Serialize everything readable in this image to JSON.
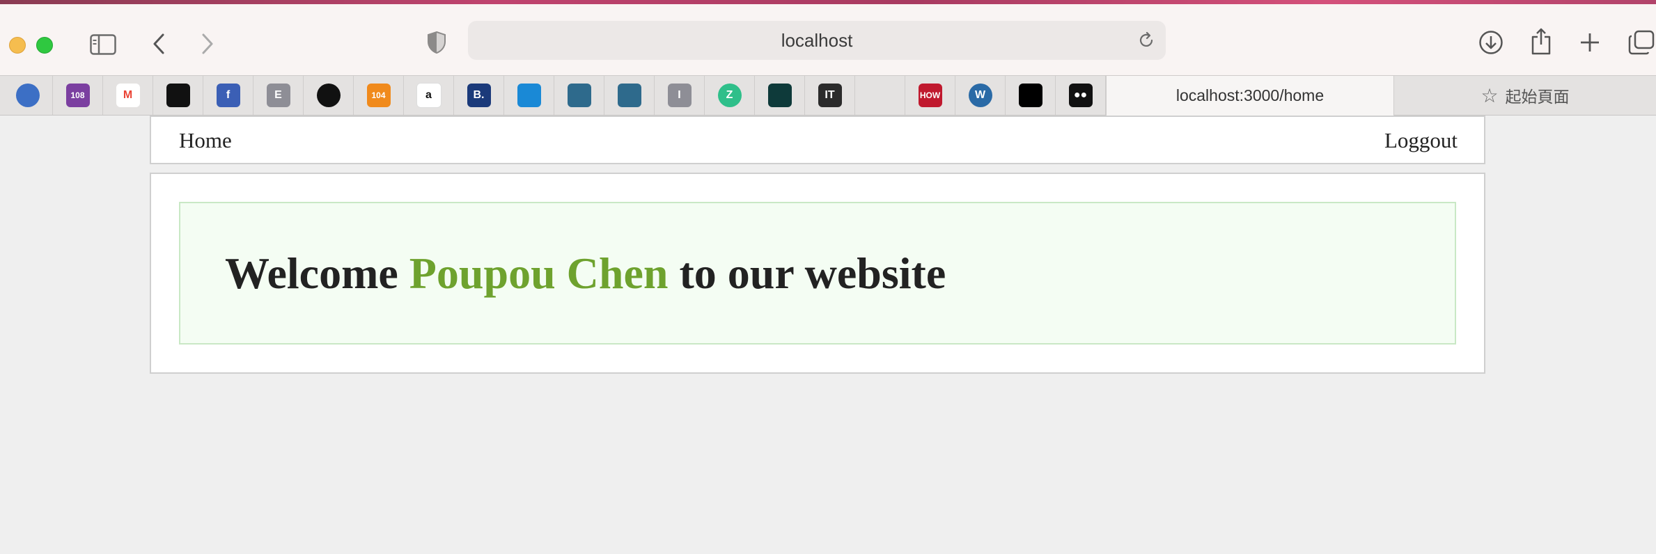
{
  "browser": {
    "address": "localhost",
    "active_tab": "localhost:3000/home",
    "other_tab": "起始頁面"
  },
  "favorites": [
    {
      "icon": "heartbeat-icon",
      "text": "",
      "color": "#3c6fc5"
    },
    {
      "icon": "108-icon",
      "text": "108",
      "color": "#7b3fa0"
    },
    {
      "icon": "gmail-icon",
      "text": "M",
      "color": "#ea4335"
    },
    {
      "icon": "github-icon",
      "text": "",
      "color": "#111111"
    },
    {
      "icon": "facebook-icon",
      "text": "f",
      "color": "#3b5fb5"
    },
    {
      "icon": "e-icon",
      "text": "E",
      "color": "#8e8e96"
    },
    {
      "icon": "circle-logo-icon",
      "text": "",
      "color": "#111111"
    },
    {
      "icon": "104-icon",
      "text": "104",
      "color": "#f08a1c"
    },
    {
      "icon": "a-icon",
      "text": "a",
      "color": "#ffffff"
    },
    {
      "icon": "booking-icon",
      "text": "B.",
      "color": "#1b3a7a"
    },
    {
      "icon": "door-icon",
      "text": "",
      "color": "#1a89d6"
    },
    {
      "icon": "mysql-icon",
      "text": "",
      "color": "#2e6a8c"
    },
    {
      "icon": "mysql-icon-2",
      "text": "",
      "color": "#2e6a8c"
    },
    {
      "icon": "i-icon",
      "text": "I",
      "color": "#8e8e96"
    },
    {
      "icon": "z-icon",
      "text": "Z",
      "color": "#2fbf8a"
    },
    {
      "icon": "gradient-icon",
      "text": "",
      "color": "#0e3a3a"
    },
    {
      "icon": "it-icon",
      "text": "IT",
      "color": "#2b2b2b"
    },
    {
      "icon": "blank-icon",
      "text": "",
      "color": "#e4e2e1"
    },
    {
      "icon": "how-icon",
      "text": "HOW",
      "color": "#c0192e"
    },
    {
      "icon": "wordpress-icon",
      "text": "W",
      "color": "#2a6aa6"
    },
    {
      "icon": "signature-icon",
      "text": "",
      "color": "#000000"
    },
    {
      "icon": "medium-icon",
      "text": "●●",
      "color": "#111111"
    }
  ],
  "nav": {
    "home": "Home",
    "logout": "Loggout"
  },
  "welcome": {
    "prefix": "Welcome ",
    "name": "Poupou Chen",
    "suffix": " to our website"
  },
  "colors": {
    "accent_name": "#6ea22e",
    "welcome_bg": "#f4fdf3"
  }
}
